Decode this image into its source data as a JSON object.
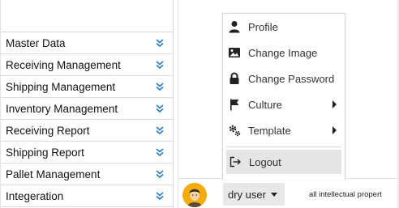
{
  "sidebar": {
    "items": [
      {
        "label": "Master Data"
      },
      {
        "label": "Receiving Management"
      },
      {
        "label": "Shipping Management"
      },
      {
        "label": "Inventory Management"
      },
      {
        "label": "Receiving Report"
      },
      {
        "label": "Shipping Report"
      },
      {
        "label": "Pallet Management"
      },
      {
        "label": "Integeration"
      }
    ],
    "chevron_icon": "double-chevron-down-icon",
    "chevron_color": "#2b7bc0"
  },
  "user_menu": {
    "items": [
      {
        "label": "Profile",
        "icon": "user-icon"
      },
      {
        "label": "Change Image",
        "icon": "image-icon"
      },
      {
        "label": "Change Password",
        "icon": "lock-icon"
      },
      {
        "label": "Culture",
        "icon": "flag-icon",
        "submenu": true
      },
      {
        "label": "Template",
        "icon": "gears-icon",
        "submenu": true
      }
    ],
    "logout": {
      "label": "Logout",
      "icon": "sign-out-icon"
    }
  },
  "user": {
    "name": "dry user",
    "avatar": "avatar-icon"
  },
  "footer": {
    "copyright": "all intellectual propert"
  }
}
